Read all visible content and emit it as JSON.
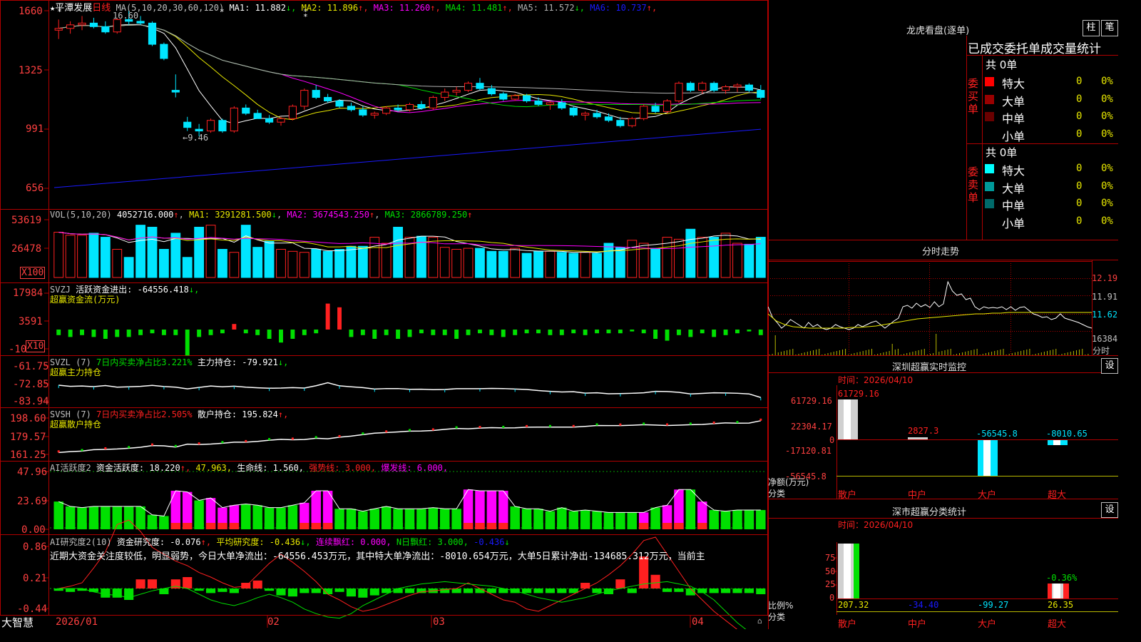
{
  "colors": {
    "bg": "#000000",
    "grid": "#b00000",
    "up": "#ff2020",
    "down": "#00e5ff",
    "green": "#00e000",
    "white": "#ffffff",
    "yellow": "#e8e800",
    "magenta": "#ff00ff",
    "blue": "#1a1aff",
    "gray": "#b0b0b0",
    "label": "#ff4040"
  },
  "main": {
    "title": "平潭发展",
    "period": "日线",
    "ma_params": "MA(5,10,20,30,60,120)",
    "ma_values": [
      {
        "label": "MA1:",
        "value": "11.882",
        "arrow": "↓",
        "color": "#ffffff"
      },
      {
        "label": "MA2:",
        "value": "11.896",
        "arrow": "↑",
        "color": "#e8e800"
      },
      {
        "label": "MA3:",
        "value": "11.260",
        "arrow": "↑",
        "color": "#ff00ff"
      },
      {
        "label": "MA4:",
        "value": "11.481",
        "arrow": "↑",
        "color": "#00e000"
      },
      {
        "label": "MA5:",
        "value": "11.572",
        "arrow": "↓",
        "color": "#b0b0b0"
      },
      {
        "label": "MA6:",
        "value": "10.737",
        "arrow": "↑",
        "color": "#1a1aff"
      }
    ],
    "y_axis": [
      "1660",
      "1325",
      "991",
      "656"
    ],
    "high_mark": "16.60",
    "low_mark": "←9.46"
  },
  "vol": {
    "title": "VOL(5,10,20)",
    "value": "4052716.000",
    "arrow": "↑",
    "ma1": "MA1: 3291281.500",
    "ma1_arrow": "↓",
    "ma2": "MA2: 3674543.250",
    "ma2_arrow": "↑",
    "ma3": "MA3: 2866789.250",
    "ma3_arrow": "↑",
    "y_axis": [
      "53619",
      "26478"
    ],
    "unit": "X100"
  },
  "svzj": {
    "title": "SVZJ",
    "label": "活跃资金进出: -64556.418",
    "arrow": "↓,",
    "name": "超赢资金流(万元)",
    "y_axis": [
      "17984",
      "3591",
      "-10"
    ],
    "unit": "X10"
  },
  "svzl": {
    "title": "SVZL (7)",
    "label1": "7日内买卖净占比3.221%",
    "label2": "主力持仓: -79.921",
    "arrow": "↓,",
    "name": "超赢主力持仓",
    "y_axis": [
      "-61.75",
      "-72.85",
      "-83.94"
    ]
  },
  "svsh": {
    "title": "SVSH (7)",
    "label1": "7日内买卖净占比2.505%",
    "label2": "散户持仓: 195.824",
    "arrow": "↑,",
    "name": "超赢散户持仓",
    "y_axis": [
      "198.60",
      "179.57",
      "161.25"
    ]
  },
  "ai1": {
    "title": "AI活跃度2",
    "l1": "资金活跃度: 18.220",
    "a1": "↑,",
    "l2": "47.963,",
    "l3": "生命线: 1.560,",
    "l4": "强势线: 3.000,",
    "l5": "爆发线: 6.000,",
    "y_axis": [
      "47.96",
      "23.69",
      "0.00"
    ]
  },
  "ai2": {
    "title": "AI研究度2(10)",
    "l1": "资金研究度: -0.076",
    "a1": "↑,",
    "l2": "平均研究度: -0.436",
    "a2": "↓,",
    "l3": "连续飘红: 0.000,",
    "l4": "N日飘红: 3.000,",
    "l5": "-0.436",
    "a5": "↓",
    "note": "近期大资金关注度较低，明显弱势，今日大单净流出：-64556.453万元，其中特大单净流出：-8010.654万元，大单5日累计净出-134685.312万元，当前主",
    "y_axis": [
      "0.86",
      "0.21",
      "-0.44"
    ]
  },
  "bottom": {
    "brand": "大智慧",
    "dates": [
      "2026/01",
      "02",
      "03",
      "04"
    ]
  },
  "right": {
    "title": "龙虎看盘(逐单)",
    "btn1": "柱",
    "btn2": "笔",
    "subtitle": "已成交委托单成交量统计",
    "buy_label": "委买单",
    "sell_label": "委卖单",
    "buy_total": "共 0单",
    "sell_total": "共 0单",
    "buy_rows": [
      {
        "name": "特大",
        "v": "0",
        "p": "0%",
        "c": "#ff0000"
      },
      {
        "name": "大单",
        "v": "0",
        "p": "0%",
        "c": "#9a0000"
      },
      {
        "name": "中单",
        "v": "0",
        "p": "0%",
        "c": "#6a0000"
      },
      {
        "name": "小单",
        "v": "0",
        "p": "0%",
        "c": ""
      }
    ],
    "sell_rows": [
      {
        "name": "特大",
        "v": "0",
        "p": "0%",
        "c": "#00ffff"
      },
      {
        "name": "大单",
        "v": "0",
        "p": "0%",
        "c": "#009a9a"
      },
      {
        "name": "中单",
        "v": "0",
        "p": "0%",
        "c": "#006a6a"
      },
      {
        "name": "小单",
        "v": "0",
        "p": "0%",
        "c": ""
      }
    ],
    "intraday_title": "分时走势",
    "intraday_y": [
      "12.19",
      "11.91",
      "11.62",
      "16384"
    ],
    "intraday_unit": "分时",
    "sz_title": "深圳超赢实时监控",
    "sz_btn": "设",
    "sz_time": "时间：2026/04/10",
    "sz_y": [
      "61729.16",
      "22304.17",
      "0",
      "-17120.81",
      "-56545.8"
    ],
    "sz_unit1": "净额(万元)",
    "sz_unit2": "分类",
    "sz_values": [
      "61729.16",
      "2827.3",
      "-56545.8",
      "-8010.65"
    ],
    "sz_cats": [
      "散户",
      "中户",
      "大户",
      "超大"
    ],
    "cls_title": "深市超赢分类统计",
    "cls_btn": "设",
    "cls_time": "时间：2026/04/10",
    "cls_y": [
      "75",
      "50",
      "25",
      "0"
    ],
    "cls_unit1": "比例%",
    "cls_unit2": "分类",
    "cls_values": [
      "207.32",
      "-34.40",
      "-99.27",
      "26.35"
    ],
    "cls_label": "-0.36%",
    "cls_cats": [
      "散户",
      "中户",
      "大户",
      "超大"
    ]
  },
  "chart_data": {
    "type": "candlestick",
    "title": "平潭发展 日线",
    "dates": [
      "2026/01",
      "02",
      "03",
      "04"
    ],
    "candles": [
      [
        15.5,
        16.1,
        15.0,
        15.6
      ],
      [
        15.6,
        16.0,
        15.3,
        15.8
      ],
      [
        15.8,
        16.3,
        15.5,
        15.9
      ],
      [
        15.9,
        16.2,
        15.6,
        15.7
      ],
      [
        15.7,
        16.0,
        15.3,
        15.4
      ],
      [
        15.4,
        16.2,
        15.3,
        16.1
      ],
      [
        16.1,
        16.6,
        15.8,
        16.0
      ],
      [
        16.0,
        16.3,
        15.8,
        15.9
      ],
      [
        15.9,
        16.0,
        14.6,
        14.7
      ],
      [
        14.7,
        14.8,
        13.8,
        13.9
      ],
      [
        12.1,
        13.0,
        11.7,
        12.0
      ],
      [
        10.3,
        10.6,
        9.8,
        10.0
      ],
      [
        9.9,
        10.2,
        9.5,
        9.8
      ],
      [
        9.8,
        10.5,
        9.7,
        10.4
      ],
      [
        10.4,
        10.5,
        9.7,
        9.8
      ],
      [
        9.8,
        11.2,
        9.7,
        11.1
      ],
      [
        11.1,
        11.3,
        10.7,
        10.8
      ],
      [
        10.8,
        11.0,
        10.5,
        10.5
      ],
      [
        10.5,
        10.7,
        10.2,
        10.3
      ],
      [
        10.3,
        10.6,
        10.1,
        10.5
      ],
      [
        10.5,
        11.3,
        10.4,
        11.2
      ],
      [
        11.2,
        12.2,
        11.0,
        12.1
      ],
      [
        12.1,
        12.4,
        11.6,
        11.7
      ],
      [
        11.7,
        11.9,
        11.4,
        11.5
      ],
      [
        11.5,
        11.6,
        11.1,
        11.2
      ],
      [
        11.2,
        11.4,
        10.9,
        11.0
      ],
      [
        11.0,
        11.2,
        10.6,
        10.7
      ],
      [
        10.7,
        10.9,
        10.5,
        10.8
      ],
      [
        10.8,
        11.2,
        10.7,
        11.1
      ],
      [
        11.1,
        11.3,
        10.9,
        11.0
      ],
      [
        11.0,
        11.4,
        10.9,
        11.3
      ],
      [
        11.3,
        11.5,
        11.0,
        11.1
      ],
      [
        11.1,
        11.8,
        11.0,
        11.7
      ],
      [
        11.7,
        12.2,
        11.5,
        12.0
      ],
      [
        12.0,
        12.3,
        11.8,
        12.1
      ],
      [
        12.1,
        12.6,
        12.0,
        12.5
      ],
      [
        12.5,
        12.8,
        12.1,
        12.2
      ],
      [
        12.2,
        12.4,
        11.8,
        11.9
      ],
      [
        11.9,
        12.0,
        11.5,
        11.6
      ],
      [
        11.6,
        11.9,
        11.5,
        11.8
      ],
      [
        11.8,
        11.9,
        11.4,
        11.5
      ],
      [
        11.5,
        11.7,
        11.2,
        11.3
      ],
      [
        11.3,
        11.5,
        11.0,
        11.4
      ],
      [
        11.4,
        11.6,
        11.0,
        11.1
      ],
      [
        11.1,
        11.2,
        10.6,
        10.7
      ],
      [
        10.7,
        10.9,
        10.4,
        10.8
      ],
      [
        10.8,
        11.0,
        10.5,
        10.6
      ],
      [
        10.6,
        10.8,
        10.3,
        10.4
      ],
      [
        10.4,
        10.6,
        10.0,
        10.1
      ],
      [
        10.1,
        10.6,
        10.0,
        10.5
      ],
      [
        10.5,
        11.3,
        10.4,
        11.2
      ],
      [
        11.2,
        11.4,
        10.8,
        10.9
      ],
      [
        10.9,
        11.6,
        10.8,
        11.5
      ],
      [
        11.5,
        12.6,
        11.4,
        12.5
      ],
      [
        12.5,
        12.6,
        12.0,
        12.1
      ],
      [
        12.1,
        12.6,
        11.9,
        12.5
      ],
      [
        12.5,
        12.6,
        12.0,
        12.1
      ],
      [
        12.1,
        12.4,
        11.9,
        12.3
      ],
      [
        12.3,
        12.5,
        12.0,
        12.4
      ],
      [
        12.4,
        12.5,
        12.0,
        12.1
      ],
      [
        12.1,
        12.4,
        11.6,
        11.7
      ]
    ],
    "volume": [
      45,
      42,
      42,
      44,
      40,
      28,
      20,
      52,
      50,
      28,
      44,
      20,
      50,
      52,
      28,
      25,
      52,
      30,
      36,
      28,
      26,
      25,
      28,
      26,
      28,
      31,
      31,
      40,
      34,
      50,
      40,
      41,
      40,
      30,
      28,
      29,
      29,
      26,
      26,
      29,
      24,
      26,
      26,
      25,
      24,
      25,
      24,
      34,
      30,
      37,
      34,
      29,
      40,
      38,
      48,
      40,
      40,
      44,
      34,
      33,
      40
    ],
    "svzj": [
      -3,
      -4,
      -3,
      -4,
      -5,
      -4,
      -4,
      -3,
      -2,
      -3,
      -3,
      -14,
      -4,
      -3,
      -2,
      3,
      -2,
      -3,
      -5,
      -7,
      -5,
      -3,
      -2,
      14,
      12,
      -4,
      -3,
      -5,
      -3,
      -5,
      -4,
      -2,
      -3,
      -3,
      -5,
      -3,
      -2,
      -3,
      -4,
      -3,
      -2,
      -2,
      -3,
      -3,
      -2,
      -3,
      -2,
      -2,
      -2,
      -1,
      -2,
      -5,
      -6,
      -3,
      -4,
      -2,
      -4,
      -3,
      -2,
      -1,
      -3
    ],
    "svzl": [
      -74.0,
      -74.7,
      -74.5,
      -74.9,
      -74.2,
      -75.2,
      -75.0,
      -74.7,
      -74.1,
      -74.8,
      -75.2,
      -76.3,
      -75.4,
      -74.5,
      -75.0,
      -74.6,
      -75.2,
      -75.6,
      -75.9,
      -75.8,
      -75.5,
      -75.8,
      -74.3,
      -72.4,
      -74.4,
      -75.0,
      -75.5,
      -76.4,
      -76.1,
      -76.1,
      -76.6,
      -76.5,
      -76.8,
      -76.7,
      -76.2,
      -76.2,
      -76.2,
      -76.0,
      -76.1,
      -76.4,
      -76.7,
      -77.4,
      -77.9,
      -78.3,
      -78.1,
      -79.0,
      -78.8,
      -79.4,
      -79.3,
      -79.1,
      -78.8,
      -77.9,
      -78.0,
      -78.5,
      -79.5,
      -79.2,
      -78.8,
      -78.9,
      -79.1,
      -79.5,
      -81.8
    ],
    "svsh": [
      163.2,
      164.1,
      164.6,
      166.1,
      166.4,
      166.8,
      167.6,
      168.6,
      170.3,
      170.0,
      168.8,
      171.8,
      171.4,
      171.9,
      172.7,
      173.8,
      173.8,
      174.6,
      175.8,
      176.7,
      176.3,
      176.5,
      177.8,
      177.3,
      178.9,
      180.0,
      181.6,
      183.0,
      183.7,
      184.3,
      185.1,
      185.2,
      185.8,
      187.0,
      187.9,
      187.5,
      188.3,
      188.7,
      188.4,
      188.5,
      189.2,
      189.3,
      189.3,
      189.3,
      189.3,
      190.0,
      190.9,
      190.8,
      190.8,
      191.2,
      191.7,
      191.4,
      190.9,
      191.3,
      191.7,
      192.0,
      192.8,
      193.6,
      193.3,
      193.4,
      195.8
    ],
    "ai1": [
      23,
      19,
      18,
      19,
      19,
      19,
      19,
      19,
      12,
      11,
      32,
      31,
      24,
      26,
      18,
      20,
      21,
      20,
      18,
      18,
      20,
      22,
      32,
      32,
      17,
      17,
      15,
      17,
      19,
      17,
      17,
      17,
      18,
      17,
      17,
      33,
      32,
      32,
      32,
      19,
      17,
      17,
      15,
      18,
      15,
      16,
      15,
      14,
      14,
      14,
      14,
      18,
      20,
      33,
      33,
      23,
      16,
      15,
      16,
      16,
      16
    ],
    "ai1_pink": [
      10,
      11,
      13,
      14,
      15,
      21,
      22,
      23,
      35,
      36,
      37,
      38,
      50,
      52,
      53,
      55
    ],
    "ai2": [
      -0.02,
      -0.03,
      -0.02,
      -0.03,
      -0.08,
      -0.08,
      -0.1,
      0.08,
      0.08,
      -0.05,
      0.08,
      0.1,
      -0.02,
      -0.04,
      -0.03,
      -0.04,
      0.05,
      0.07,
      -0.02,
      -0.06,
      -0.07,
      -0.04,
      -0.04,
      -0.05,
      -0.03,
      -0.07,
      -0.08,
      -0.06,
      -0.04,
      -0.04,
      -0.04,
      -0.04,
      -0.04,
      -0.04,
      -0.04,
      -0.04,
      -0.04,
      -0.04,
      -0.04,
      -0.04,
      -0.04,
      -0.04,
      -0.04,
      -0.04,
      -0.04,
      0.05,
      -0.04,
      -0.05,
      0.08,
      -0.04,
      0.28,
      0.12,
      -0.03,
      -0.03,
      -0.06,
      -0.04,
      -0.04,
      -0.04,
      -0.04,
      -0.04,
      -0.05
    ]
  }
}
